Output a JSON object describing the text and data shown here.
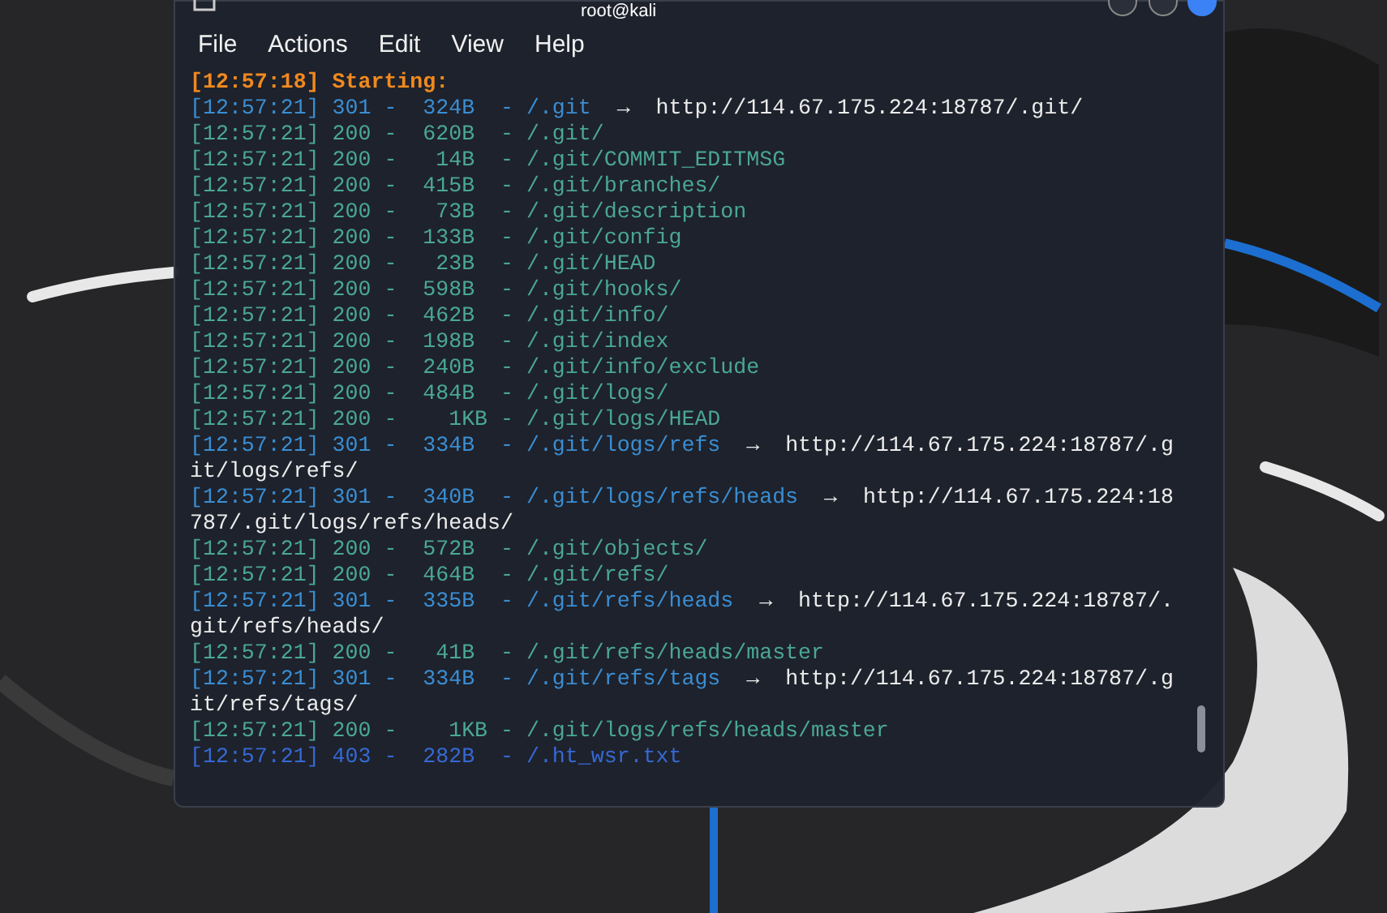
{
  "window": {
    "title": "root@kali"
  },
  "menu": [
    "File",
    "Actions",
    "Edit",
    "View",
    "Help"
  ],
  "lines": [
    {
      "kind": "banner",
      "text": "[12:57:18] Starting:"
    },
    {
      "kind": "redirect",
      "text": "[12:57:21] 301 -  324B  - /.git",
      "arrow": "→",
      "target": "http://114.67.175.224:18787/.git/"
    },
    {
      "kind": "ok",
      "text": "[12:57:21] 200 -  620B  - /.git/"
    },
    {
      "kind": "ok",
      "text": "[12:57:21] 200 -   14B  - /.git/COMMIT_EDITMSG"
    },
    {
      "kind": "ok",
      "text": "[12:57:21] 200 -  415B  - /.git/branches/"
    },
    {
      "kind": "ok",
      "text": "[12:57:21] 200 -   73B  - /.git/description"
    },
    {
      "kind": "ok",
      "text": "[12:57:21] 200 -  133B  - /.git/config"
    },
    {
      "kind": "ok",
      "text": "[12:57:21] 200 -   23B  - /.git/HEAD"
    },
    {
      "kind": "ok",
      "text": "[12:57:21] 200 -  598B  - /.git/hooks/"
    },
    {
      "kind": "ok",
      "text": "[12:57:21] 200 -  462B  - /.git/info/"
    },
    {
      "kind": "ok",
      "text": "[12:57:21] 200 -  198B  - /.git/index"
    },
    {
      "kind": "ok",
      "text": "[12:57:21] 200 -  240B  - /.git/info/exclude"
    },
    {
      "kind": "ok",
      "text": "[12:57:21] 200 -  484B  - /.git/logs/"
    },
    {
      "kind": "ok",
      "text": "[12:57:21] 200 -    1KB - /.git/logs/HEAD"
    },
    {
      "kind": "redirect",
      "text": "[12:57:21] 301 -  334B  - /.git/logs/refs",
      "arrow": "→",
      "target": "http://114.67.175.224:18787/.git/logs/refs/"
    },
    {
      "kind": "redirect",
      "text": "[12:57:21] 301 -  340B  - /.git/logs/refs/heads",
      "arrow": "→",
      "target": "http://114.67.175.224:18787/.git/logs/refs/heads/"
    },
    {
      "kind": "ok",
      "text": "[12:57:21] 200 -  572B  - /.git/objects/"
    },
    {
      "kind": "ok",
      "text": "[12:57:21] 200 -  464B  - /.git/refs/"
    },
    {
      "kind": "redirect",
      "text": "[12:57:21] 301 -  335B  - /.git/refs/heads",
      "arrow": "→",
      "target": "http://114.67.175.224:18787/.git/refs/heads/"
    },
    {
      "kind": "ok",
      "text": "[12:57:21] 200 -   41B  - /.git/refs/heads/master"
    },
    {
      "kind": "redirect",
      "text": "[12:57:21] 301 -  334B  - /.git/refs/tags",
      "arrow": "→",
      "target": "http://114.67.175.224:18787/.git/refs/tags/"
    },
    {
      "kind": "ok",
      "text": "[12:57:21] 200 -    1KB - /.git/logs/refs/heads/master"
    },
    {
      "kind": "forbidden",
      "text": "[12:57:21] 403 -  282B  - /.ht_wsr.txt"
    }
  ]
}
